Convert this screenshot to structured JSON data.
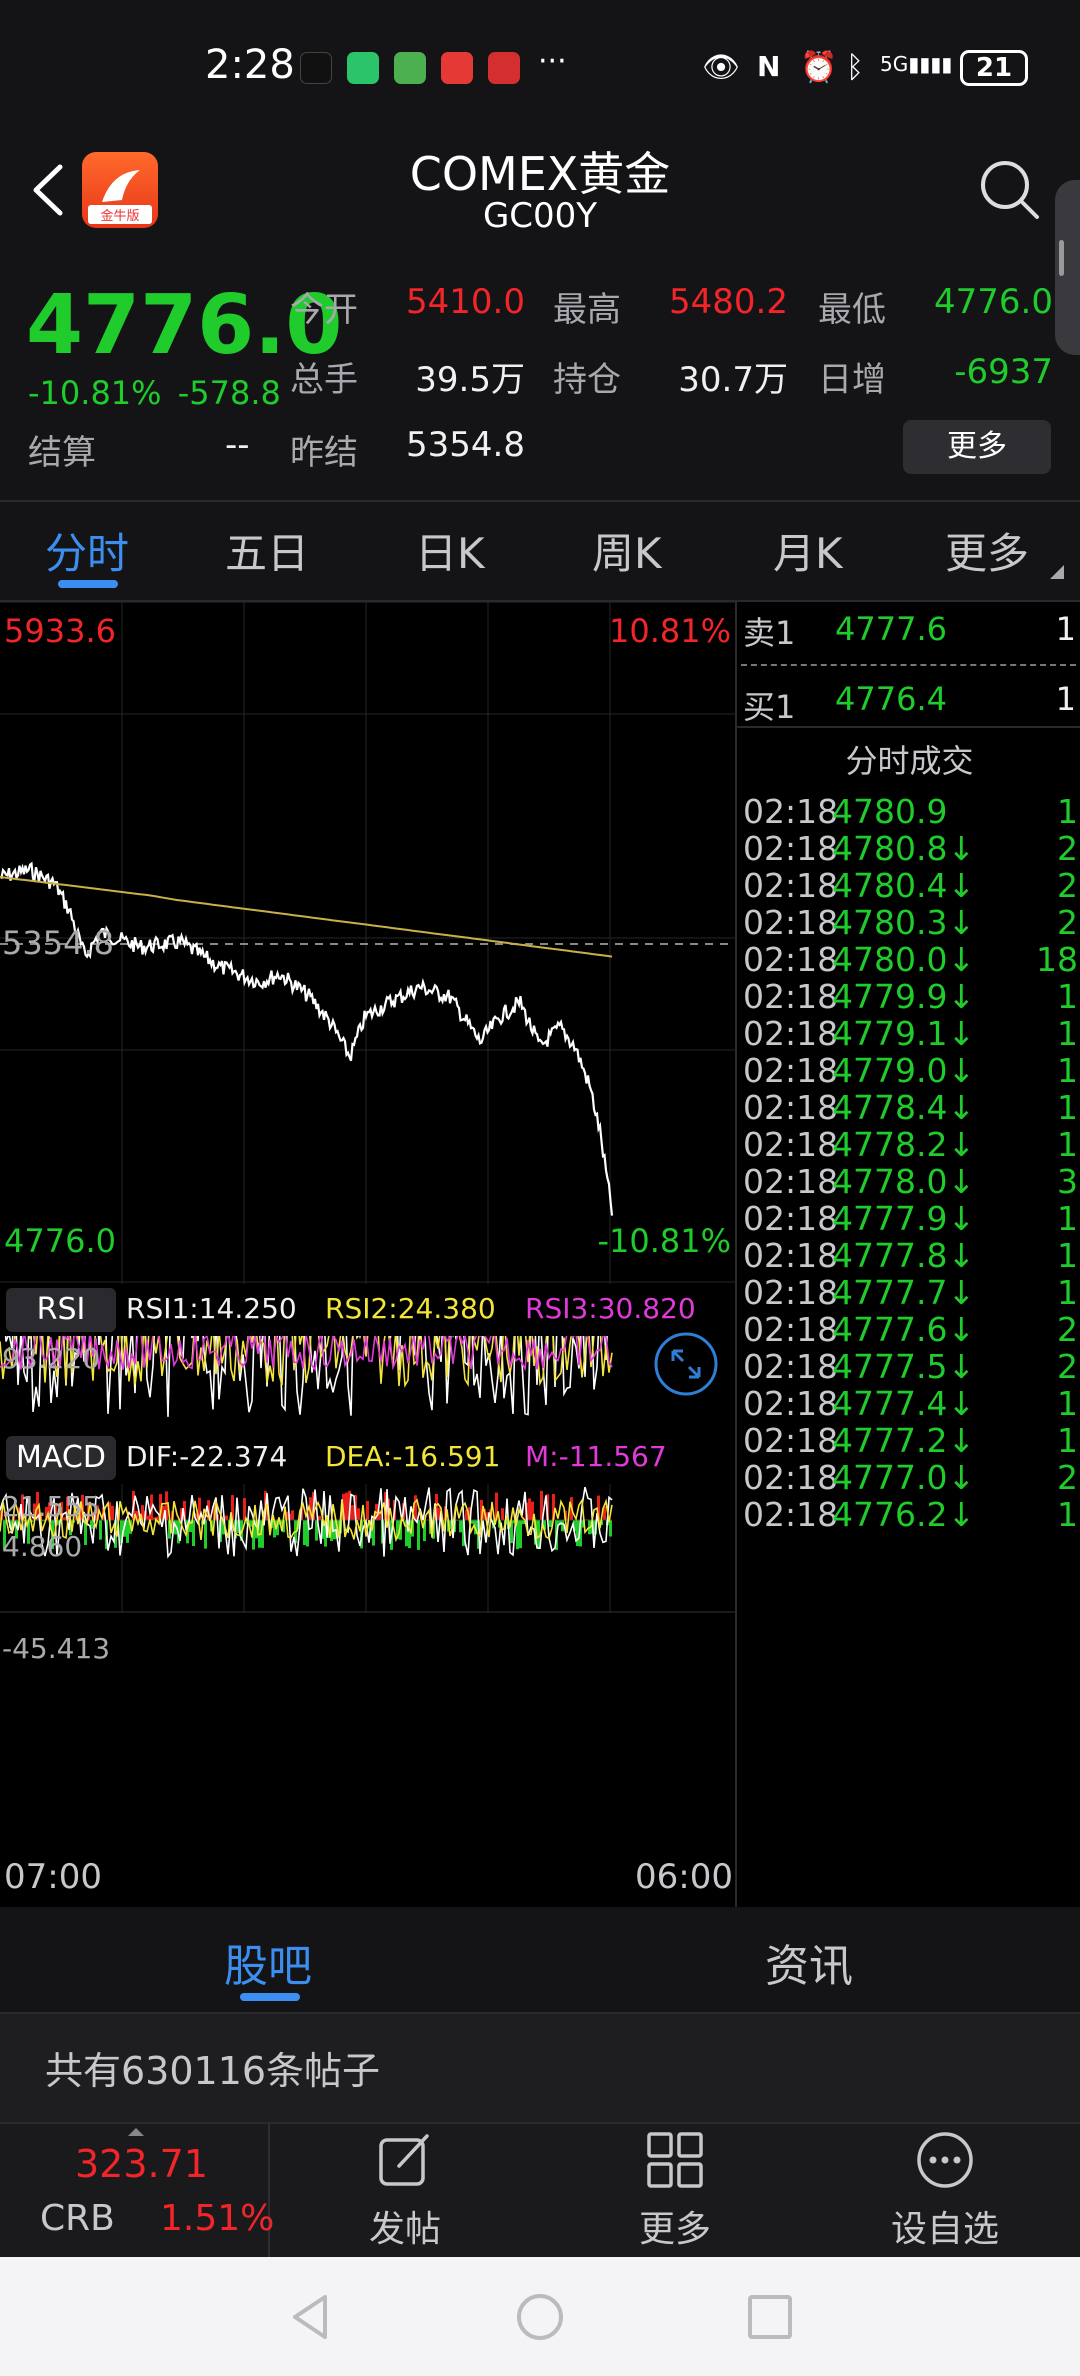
{
  "status_bar": {
    "time": "2:28",
    "battery": "21",
    "more": "···"
  },
  "header": {
    "title": "COMEX黄金",
    "subtitle": "GC00Y",
    "logo_text": "金牛版"
  },
  "quote": {
    "price": "4776.0",
    "change_pct": "-10.81%",
    "change_abs": "-578.8",
    "settle_label": "结算",
    "settle_value": "--",
    "open_label": "今开",
    "open_value": "5410.0",
    "high_label": "最高",
    "high_value": "5480.2",
    "low_label": "最低",
    "low_value": "4776.0",
    "volume_label": "总手",
    "volume_value": "39.5万",
    "oi_label": "持仓",
    "oi_value": "30.7万",
    "daily_inc_label": "日增",
    "daily_inc_value": "-6937",
    "prev_label": "昨结",
    "prev_value": "5354.8",
    "more_button": "更多"
  },
  "tabs": [
    "分时",
    "五日",
    "日K",
    "周K",
    "月K",
    "更多"
  ],
  "chart": {
    "high_price": "5933.6",
    "high_pct": "10.81%",
    "ref_price": "5354.8",
    "low_price": "4776.0",
    "low_pct": "-10.81%",
    "time_start": "07:00",
    "time_end": "06:00",
    "rsi": {
      "label": "RSI",
      "rsi1": "RSI1:14.250",
      "rsi2": "RSI2:24.380",
      "rsi3": "RSI3:30.820",
      "top": "93.220",
      "bottom": "4.860"
    },
    "macd": {
      "label": "MACD",
      "dif": "DIF:-22.374",
      "dea": "DEA:-16.591",
      "m": "M:-11.567",
      "top": "21.555",
      "bottom": "-45.413"
    }
  },
  "order_book": {
    "ask_label": "卖1",
    "ask_price": "4777.6",
    "ask_vol": "1",
    "bid_label": "买1",
    "bid_price": "4776.4",
    "bid_vol": "1",
    "trades_title": "分时成交"
  },
  "trades": [
    {
      "time": "02:18",
      "price": "4780.9",
      "arrow": "",
      "vol": "1"
    },
    {
      "time": "02:18",
      "price": "4780.8",
      "arrow": "↓",
      "vol": "2"
    },
    {
      "time": "02:18",
      "price": "4780.4",
      "arrow": "↓",
      "vol": "2"
    },
    {
      "time": "02:18",
      "price": "4780.3",
      "arrow": "↓",
      "vol": "2"
    },
    {
      "time": "02:18",
      "price": "4780.0",
      "arrow": "↓",
      "vol": "18"
    },
    {
      "time": "02:18",
      "price": "4779.9",
      "arrow": "↓",
      "vol": "1"
    },
    {
      "time": "02:18",
      "price": "4779.1",
      "arrow": "↓",
      "vol": "1"
    },
    {
      "time": "02:18",
      "price": "4779.0",
      "arrow": "↓",
      "vol": "1"
    },
    {
      "time": "02:18",
      "price": "4778.4",
      "arrow": "↓",
      "vol": "1"
    },
    {
      "time": "02:18",
      "price": "4778.2",
      "arrow": "↓",
      "vol": "1"
    },
    {
      "time": "02:18",
      "price": "4778.0",
      "arrow": "↓",
      "vol": "3"
    },
    {
      "time": "02:18",
      "price": "4777.9",
      "arrow": "↓",
      "vol": "1"
    },
    {
      "time": "02:18",
      "price": "4777.8",
      "arrow": "↓",
      "vol": "1"
    },
    {
      "time": "02:18",
      "price": "4777.7",
      "arrow": "↓",
      "vol": "1"
    },
    {
      "time": "02:18",
      "price": "4777.6",
      "arrow": "↓",
      "vol": "2"
    },
    {
      "time": "02:18",
      "price": "4777.5",
      "arrow": "↓",
      "vol": "2"
    },
    {
      "time": "02:18",
      "price": "4777.4",
      "arrow": "↓",
      "vol": "1"
    },
    {
      "time": "02:18",
      "price": "4777.2",
      "arrow": "↓",
      "vol": "1"
    },
    {
      "time": "02:18",
      "price": "4777.0",
      "arrow": "↓",
      "vol": "2"
    },
    {
      "time": "02:18",
      "price": "4776.2",
      "arrow": "↓",
      "vol": "1"
    }
  ],
  "bottom_tabs": [
    "股吧",
    "资讯"
  ],
  "post_count": "共有630116条帖子",
  "toolbar": {
    "crb_value": "323.71",
    "crb_label": "CRB",
    "crb_pct": "1.51%",
    "post_label": "发帖",
    "more_label": "更多",
    "watch_label": "设自选"
  },
  "colors": {
    "up": "#f2262a",
    "down": "#1fcc2c",
    "accent": "#3c8ff0",
    "avg_line": "#c8b04a"
  }
}
